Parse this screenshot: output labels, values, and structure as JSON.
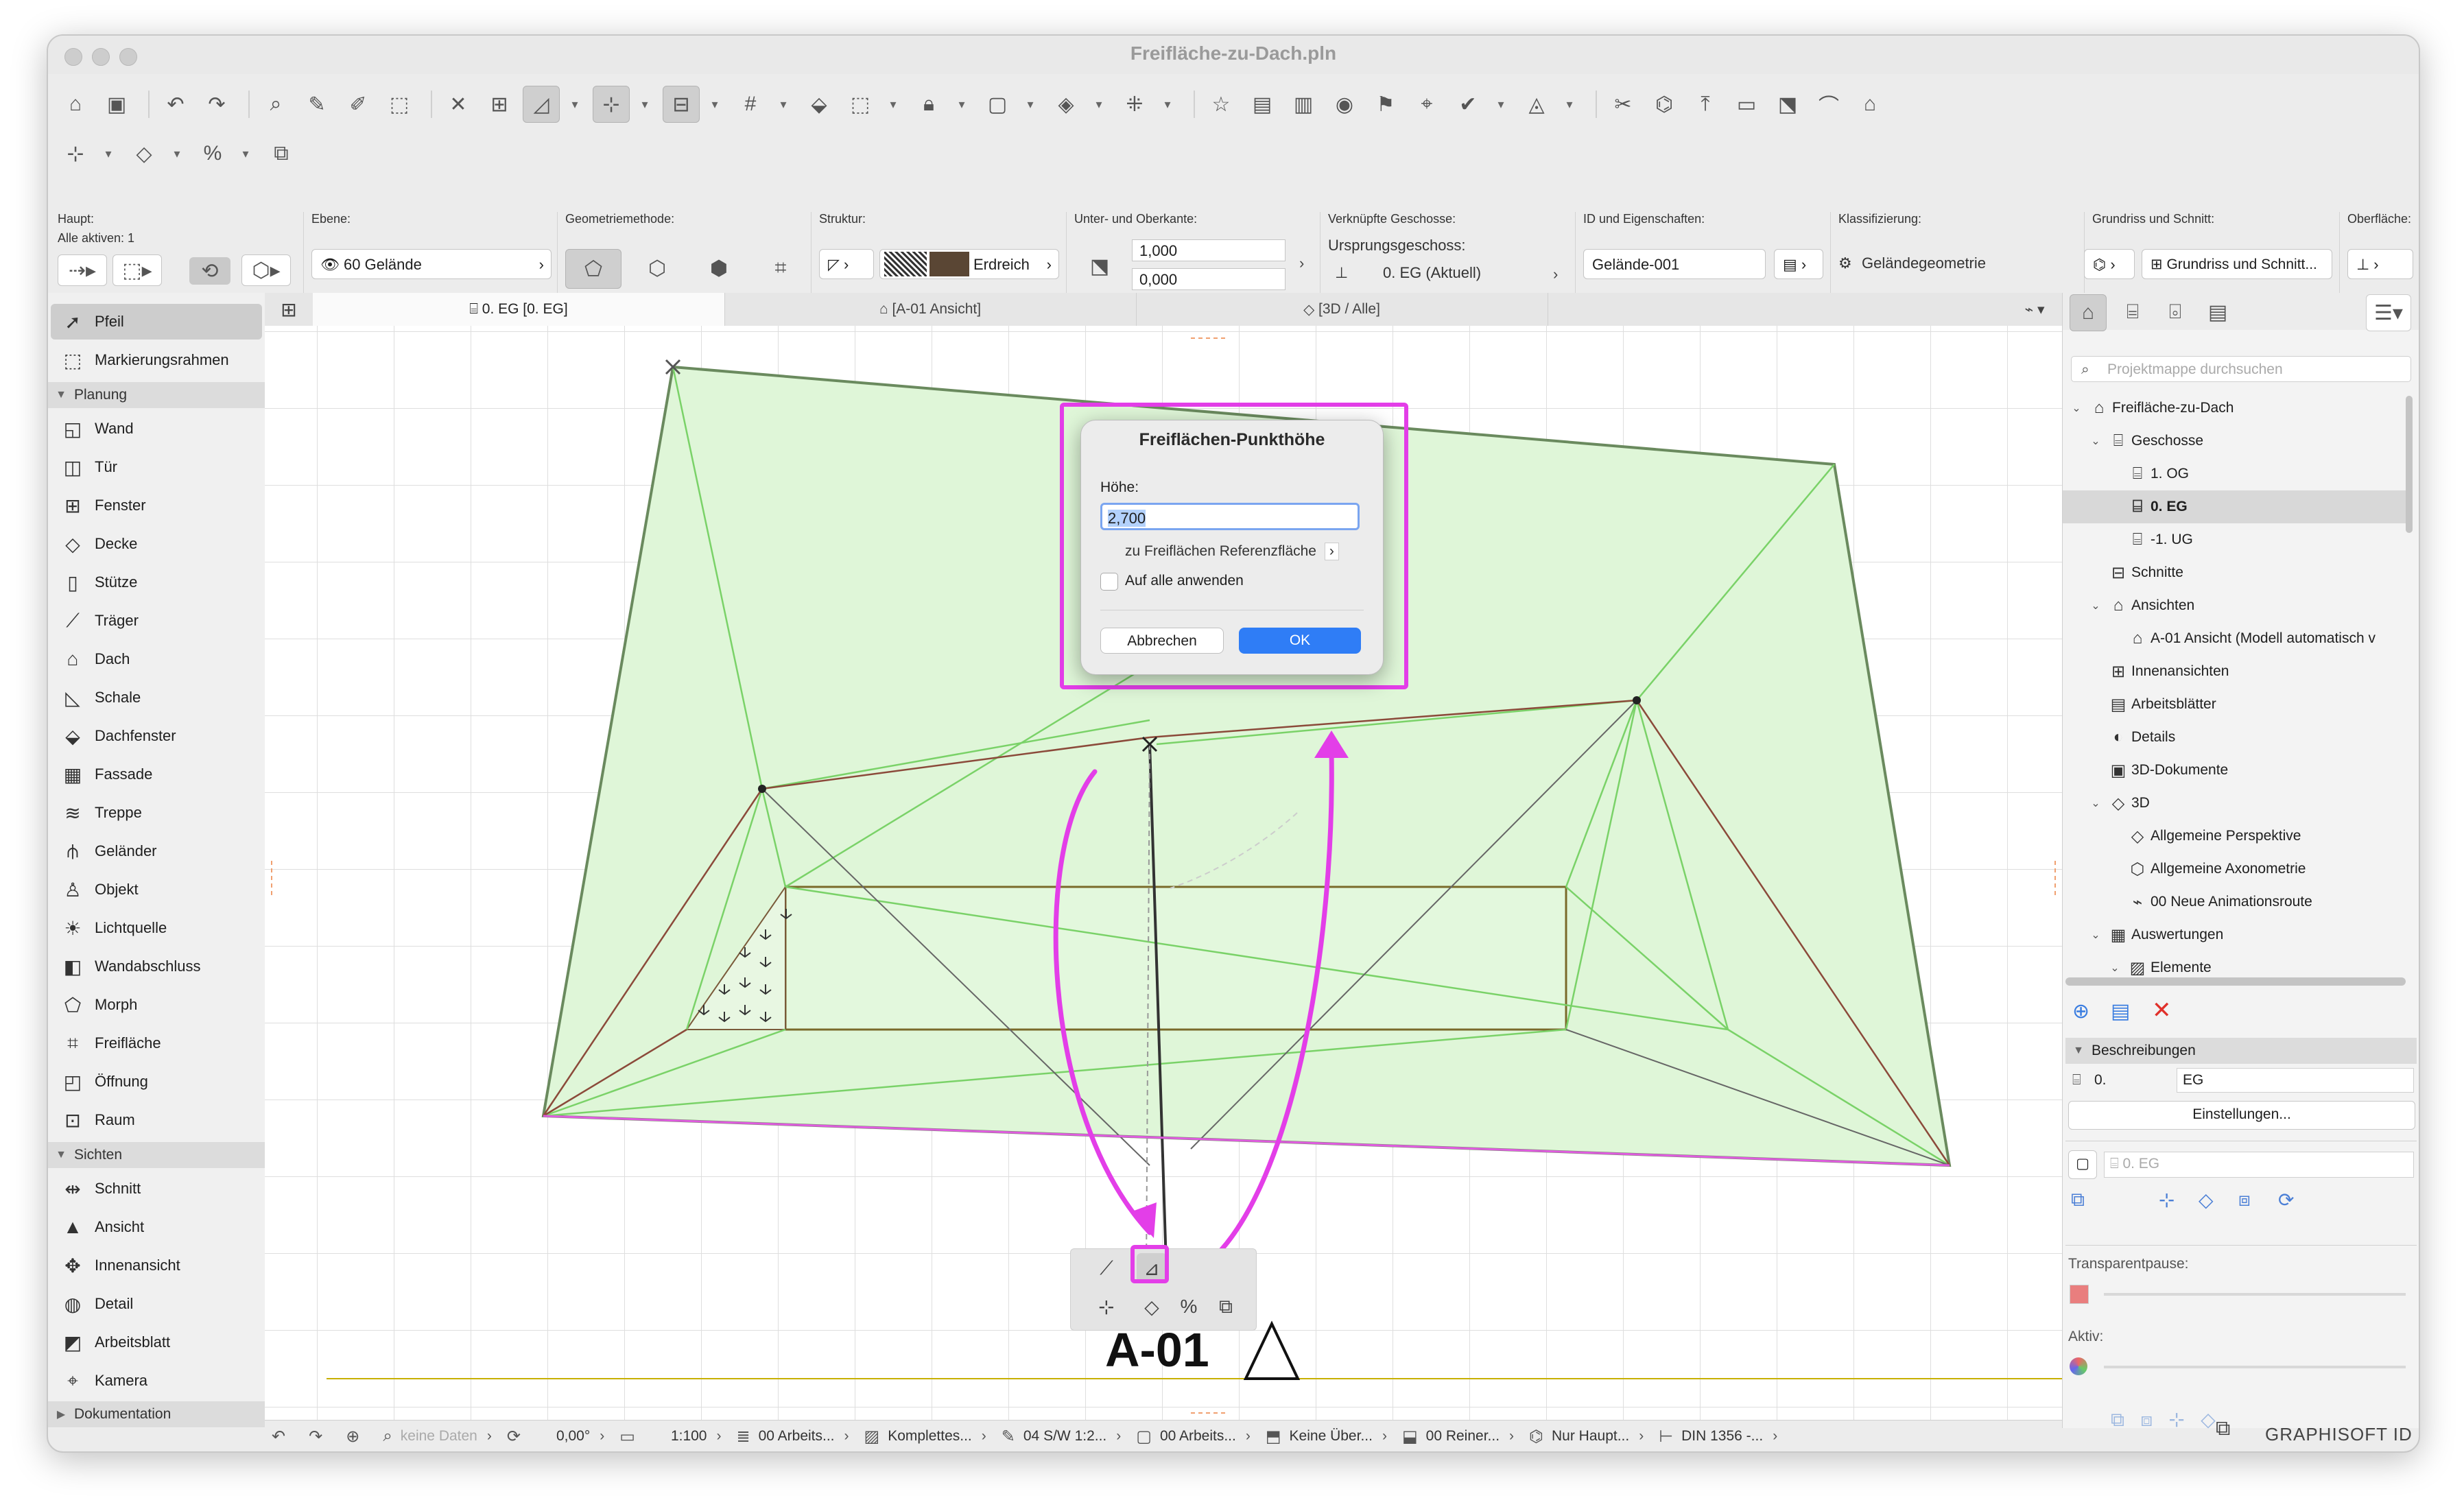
{
  "window": {
    "title": "Freifläche-zu-Dach.pln"
  },
  "infobox": {
    "haupt_label": "Haupt:",
    "haupt_sub": "Alle aktiven: 1",
    "ebene_label": "Ebene:",
    "ebene_value": "60 Gelände",
    "geom_label": "Geometriemethode:",
    "struktur_label": "Struktur:",
    "struktur_value": "Erdreich",
    "kante_label": "Unter- und Oberkante:",
    "kante_top": "1,000",
    "kante_bottom": "0,000",
    "geschoss_label": "Verknüpfte Geschosse:",
    "ursprung_label": "Ursprungsgeschoss:",
    "ursprung_value": "0. EG (Aktuell)",
    "id_label": "ID und Eigenschaften:",
    "id_value": "Gelände-001",
    "klass_label": "Klassifizierung:",
    "klass_value": "Geländegeometrie",
    "grundriss_label": "Grundriss und Schnitt:",
    "grundriss_value": "Grundriss und Schnitt...",
    "oberflaeche_label": "Oberfläche:"
  },
  "toolbox": {
    "pfeil": "Pfeil",
    "markierung": "Markierungsrahmen",
    "planung": "Planung",
    "wand": "Wand",
    "tuer": "Tür",
    "fenster": "Fenster",
    "decke": "Decke",
    "stuetze": "Stütze",
    "traeger": "Träger",
    "dach": "Dach",
    "schale": "Schale",
    "dachfenster": "Dachfenster",
    "fassade": "Fassade",
    "treppe": "Treppe",
    "gelaender": "Geländer",
    "objekt": "Objekt",
    "lichtquelle": "Lichtquelle",
    "wandabschluss": "Wandabschluss",
    "morph": "Morph",
    "freiflaeche": "Freifläche",
    "oeffnung": "Öffnung",
    "raum": "Raum",
    "sichten": "Sichten",
    "schnitt": "Schnitt",
    "ansicht": "Ansicht",
    "innenansicht": "Innenansicht",
    "detail": "Detail",
    "arbeitsblatt": "Arbeitsblatt",
    "kamera": "Kamera",
    "dokumentation": "Dokumentation"
  },
  "tabs": {
    "grundriss": "0. EG [0. EG]",
    "ansicht": "[A-01 Ansicht]",
    "dreid": "[3D / Alle]"
  },
  "canvas": {
    "marker_label": "A-01"
  },
  "dialog": {
    "title": "Freiflächen-Punkthöhe",
    "hoehe_label": "Höhe:",
    "hoehe_value": "2,700",
    "ref_label": "zu Freiflächen Referenzfläche",
    "apply_all": "Auf alle anwenden",
    "cancel": "Abbrechen",
    "ok": "OK"
  },
  "status": {
    "keine_daten": "keine Daten",
    "angle": "0,00°",
    "scale": "1:100",
    "ebenen": "00 Arbeits...",
    "modell": "Komplettes...",
    "stift": "04 S/W 1:2...",
    "ansicht": "00 Arbeits...",
    "ueber": "Keine Über...",
    "reno": "00 Reiner...",
    "struktur": "Nur Haupt...",
    "bemass": "DIN 1356 -..."
  },
  "navigator": {
    "search_placeholder": "Projektmappe durchsuchen",
    "tree": [
      {
        "label": "Freifläche-zu-Dach",
        "level": 0,
        "twisty": "v",
        "icon": "⌂"
      },
      {
        "label": "Geschosse",
        "level": 1,
        "twisty": "v",
        "icon": "⌸"
      },
      {
        "label": "1. OG",
        "level": 2,
        "twisty": "",
        "icon": "⌸"
      },
      {
        "label": "0. EG",
        "level": 2,
        "twisty": "",
        "icon": "⌸"
      },
      {
        "label": "-1. UG",
        "level": 2,
        "twisty": "",
        "icon": "⌸"
      },
      {
        "label": "Schnitte",
        "level": 1,
        "twisty": "",
        "icon": "⊟"
      },
      {
        "label": "Ansichten",
        "level": 1,
        "twisty": "v",
        "icon": "⌂"
      },
      {
        "label": "A-01 Ansicht (Modell automatisch v",
        "level": 2,
        "twisty": "",
        "icon": "⌂"
      },
      {
        "label": "Innenansichten",
        "level": 1,
        "twisty": "",
        "icon": "⊞"
      },
      {
        "label": "Arbeitsblätter",
        "level": 1,
        "twisty": "",
        "icon": "▤"
      },
      {
        "label": "Details",
        "level": 1,
        "twisty": "",
        "icon": "◐"
      },
      {
        "label": "3D-Dokumente",
        "level": 1,
        "twisty": "",
        "icon": "▣"
      },
      {
        "label": "3D",
        "level": 1,
        "twisty": "v",
        "icon": "◇"
      },
      {
        "label": "Allgemeine Perspektive",
        "level": 2,
        "twisty": "",
        "icon": "◇"
      },
      {
        "label": "Allgemeine Axonometrie",
        "level": 2,
        "twisty": "",
        "icon": "⬡"
      },
      {
        "label": "00 Neue Animationsroute",
        "level": 2,
        "twisty": "",
        "icon": "⌁"
      },
      {
        "label": "Auswertungen",
        "level": 1,
        "twisty": "v",
        "icon": "▦"
      },
      {
        "label": "Elemente",
        "level": 2,
        "twisty": "v",
        "icon": "▨"
      }
    ],
    "beschreibungen": "Beschreibungen",
    "prop_key": "0.",
    "prop_value": "EG",
    "einstellungen": "Einstellungen...",
    "geschoss_field": "0. EG",
    "transparent_label": "Transparentpause:",
    "aktiv_label": "Aktiv:"
  },
  "footer": {
    "brand": "GRAPHISOFT ID"
  },
  "colors": {
    "accent": "#2f7df6",
    "highlight": "#e33ee8",
    "mesh_fill": "#d9f6d2",
    "mesh_edge_green": "#6fcf5a",
    "mesh_edge_brown": "#8b4a3a"
  }
}
